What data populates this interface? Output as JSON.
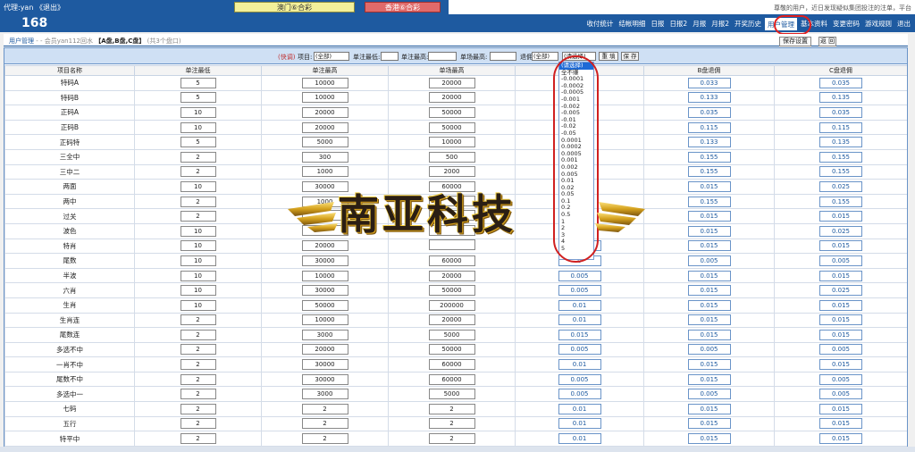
{
  "topbar": {
    "agent": "代理:yan 《退出》",
    "macau_btn": "澳门⑥合彩",
    "hk_btn": "香港⑥合彩",
    "notice": "尊敬的用户，近日发现疑似集团投注的注单，平台"
  },
  "header": {
    "site_number": "168",
    "nav": [
      "收付统计",
      "结帐明细",
      "日报",
      "日报2",
      "月报",
      "月报2",
      "开奖历史",
      "用户管理",
      "基本资料",
      "变更密码",
      "游戏规则",
      "退出"
    ],
    "active_nav": "用户管理"
  },
  "breadcrumb": {
    "root": "用户管理",
    "sep": "- -",
    "member": "会员yan112回水",
    "plates": "【A盘,B盘,C盘】",
    "count": "(共3个盘口)"
  },
  "actions": {
    "save_settings": "保存设置",
    "back": "返 回"
  },
  "filter": {
    "quick": "(快调)",
    "item_label": "项目:",
    "item_value": "(全部)",
    "single_min_label": "单注最低:",
    "single_max_label": "单注最高:",
    "single_field_label": "单场最高:",
    "retreat_label": "退佣:",
    "retreat_value": "(全部)",
    "select_value": "(请选择)",
    "reset": "重 填",
    "save": "保 存"
  },
  "table": {
    "headers": [
      "项目名称",
      "单注最低",
      "单注最高",
      "单场最高",
      "A盘退佣",
      "B盘退佣",
      "C盘退佣"
    ],
    "rows": [
      {
        "name": "特码A",
        "min": "5",
        "max": "10000",
        "field": "20000",
        "a": "",
        "b": "0.033",
        "c": "0.035"
      },
      {
        "name": "特码B",
        "min": "5",
        "max": "10000",
        "field": "20000",
        "a": "",
        "b": "0.133",
        "c": "0.135"
      },
      {
        "name": "正码A",
        "min": "10",
        "max": "20000",
        "field": "50000",
        "a": "",
        "b": "0.035",
        "c": "0.035"
      },
      {
        "name": "正码B",
        "min": "10",
        "max": "20000",
        "field": "50000",
        "a": "",
        "b": "0.115",
        "c": "0.115"
      },
      {
        "name": "正码特",
        "min": "5",
        "max": "5000",
        "field": "10000",
        "a": "",
        "b": "0.133",
        "c": "0.135"
      },
      {
        "name": "三全中",
        "min": "2",
        "max": "300",
        "field": "500",
        "a": "",
        "b": "0.155",
        "c": "0.155"
      },
      {
        "name": "三中二",
        "min": "2",
        "max": "1000",
        "field": "2000",
        "a": "",
        "b": "0.155",
        "c": "0.155"
      },
      {
        "name": "两面",
        "min": "10",
        "max": "30000",
        "field": "60000",
        "a": "",
        "b": "0.015",
        "c": "0.025"
      },
      {
        "name": "两中",
        "min": "2",
        "max": "1000",
        "field": "",
        "a": "",
        "b": "0.155",
        "c": "0.155"
      },
      {
        "name": "过关",
        "min": "2",
        "max": "",
        "field": "",
        "a": "",
        "b": "0.015",
        "c": "0.015"
      },
      {
        "name": "波色",
        "min": "10",
        "max": "",
        "field": "",
        "a": "",
        "b": "0.015",
        "c": "0.025"
      },
      {
        "name": "特肖",
        "min": "10",
        "max": "20000",
        "field": "",
        "a": "0.005",
        "b": "0.015",
        "c": "0.015"
      },
      {
        "name": "尾数",
        "min": "10",
        "max": "30000",
        "field": "60000",
        "a": "0",
        "b": "0.005",
        "c": "0.005"
      },
      {
        "name": "半波",
        "min": "10",
        "max": "10000",
        "field": "20000",
        "a": "0.005",
        "b": "0.015",
        "c": "0.015"
      },
      {
        "name": "六肖",
        "min": "10",
        "max": "30000",
        "field": "50000",
        "a": "0.005",
        "b": "0.015",
        "c": "0.025"
      },
      {
        "name": "生肖",
        "min": "10",
        "max": "50000",
        "field": "200000",
        "a": "0.01",
        "b": "0.015",
        "c": "0.015"
      },
      {
        "name": "生肖连",
        "min": "2",
        "max": "10000",
        "field": "20000",
        "a": "0.01",
        "b": "0.015",
        "c": "0.015"
      },
      {
        "name": "尾数连",
        "min": "2",
        "max": "3000",
        "field": "5000",
        "a": "0.015",
        "b": "0.015",
        "c": "0.015"
      },
      {
        "name": "多选不中",
        "min": "2",
        "max": "20000",
        "field": "50000",
        "a": "0.005",
        "b": "0.005",
        "c": "0.005"
      },
      {
        "name": "一肖不中",
        "min": "2",
        "max": "30000",
        "field": "60000",
        "a": "0.01",
        "b": "0.015",
        "c": "0.015"
      },
      {
        "name": "尾数不中",
        "min": "2",
        "max": "30000",
        "field": "60000",
        "a": "0.005",
        "b": "0.015",
        "c": "0.005"
      },
      {
        "name": "多选中一",
        "min": "2",
        "max": "3000",
        "field": "5000",
        "a": "0.005",
        "b": "0.005",
        "c": "0.005"
      },
      {
        "name": "七码",
        "min": "2",
        "max": "2",
        "field": "2",
        "a": "0.01",
        "b": "0.015",
        "c": "0.015"
      },
      {
        "name": "五行",
        "min": "2",
        "max": "2",
        "field": "2",
        "a": "0.01",
        "b": "0.015",
        "c": "0.015"
      },
      {
        "name": "特平中",
        "min": "2",
        "max": "2",
        "field": "2",
        "a": "0.01",
        "b": "0.015",
        "c": "0.015"
      }
    ]
  },
  "dropdown": {
    "options": [
      "(请选择)",
      "全不赚",
      "-0.0001",
      "-0.0002",
      "-0.0005",
      "-0.001",
      "-0.002",
      "-0.005",
      "-0.01",
      "-0.02",
      "-0.05",
      "0.0001",
      "0.0002",
      "0.0005",
      "0.001",
      "0.002",
      "0.005",
      "0.01",
      "0.02",
      "0.05",
      "0.1",
      "0.2",
      "0.5",
      "1",
      "2",
      "3",
      "4",
      "5"
    ],
    "selected": "(请选择)"
  },
  "watermark": {
    "text": "南亚科技"
  },
  "colors": {
    "brand": "#1e5aa0",
    "highlight": "#d02020"
  }
}
